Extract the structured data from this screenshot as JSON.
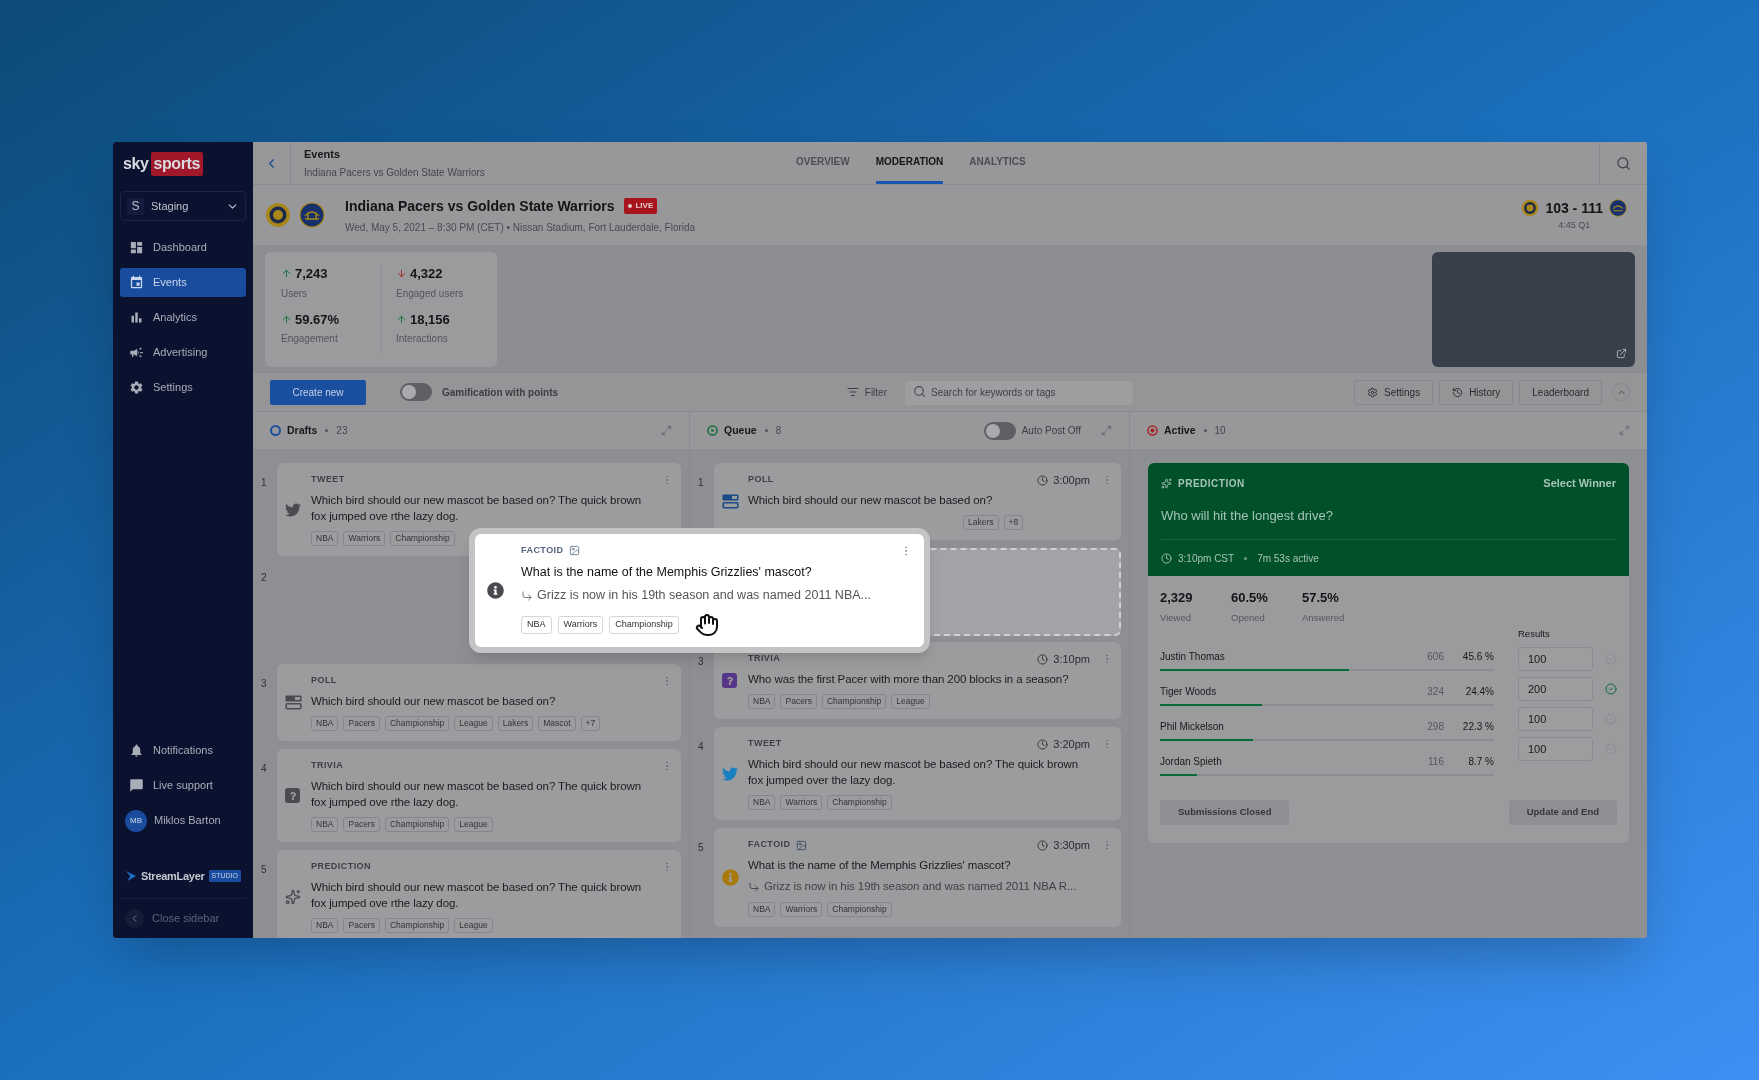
{
  "sidebar": {
    "logo": {
      "word_1": "sky",
      "word_2": "sports"
    },
    "workspace": {
      "initial": "S",
      "name": "Staging"
    },
    "nav": [
      {
        "kind": "dashboard",
        "label": "Dashboard",
        "selected": false
      },
      {
        "kind": "events",
        "label": "Events",
        "selected": true
      },
      {
        "kind": "analytics",
        "label": "Analytics",
        "selected": false
      },
      {
        "kind": "advertising",
        "label": "Advertising",
        "selected": false
      },
      {
        "kind": "settings",
        "label": "Settings",
        "selected": false
      }
    ],
    "bottom": [
      {
        "kind": "notifications",
        "label": "Notifications"
      },
      {
        "kind": "support",
        "label": "Live support"
      }
    ],
    "user": {
      "initials": "MB",
      "name": "Miklos Barton"
    },
    "brand": {
      "name": "StreamLayer",
      "badge": "STUDIO"
    },
    "close": "Close sidebar"
  },
  "breadcrumb": {
    "title": "Events",
    "subtitle": "Indiana Pacers vs Golden State Warriors"
  },
  "tabs": [
    {
      "label": "OVERVIEW",
      "selected": false
    },
    {
      "label": "MODERATION",
      "selected": true
    },
    {
      "label": "ANALYTICS",
      "selected": false
    }
  ],
  "event": {
    "title": "Indiana Pacers vs Golden State Warriors",
    "live": "LIVE",
    "meta": "Wed, May 5, 2021 – 8:30 PM (CET) • Nissan Stadium, Fort Lauderdale, Florida",
    "score": "103 - 111",
    "clock": "4:45 Q1"
  },
  "stats": [
    {
      "value": "7,243",
      "label": "Users",
      "rising": true
    },
    {
      "value": "4,322",
      "label": "Engaged users",
      "rising": false
    },
    {
      "value": "59.67%",
      "label": "Engagement",
      "rising": true
    },
    {
      "value": "18,156",
      "label": "Interactions",
      "rising": true
    }
  ],
  "toolbar": {
    "create": "Create new",
    "gamification": {
      "label": "Gamification with points",
      "on": false
    },
    "filter": "Filter",
    "search_placeholder": "Search for keywords or tags",
    "buttons": [
      {
        "kind": "settings",
        "label": "Settings"
      },
      {
        "kind": "history",
        "label": "History"
      },
      {
        "kind": "plain",
        "label": "Leaderboard"
      }
    ]
  },
  "drafts": {
    "title": "Drafts",
    "count": "23",
    "colored_icons": false,
    "items": [
      {
        "kind": "tweet",
        "number": "1",
        "type": "TWEET",
        "text": "Which bird should our new mascot be based on? The quick brown fox jumped ove rthe lazy dog.",
        "tags": [
          "NBA",
          "Warriors",
          "Championship"
        ]
      },
      {
        "kind": "empty",
        "number": "2"
      },
      {
        "kind": "poll",
        "number": "3",
        "type": "POLL",
        "text": "Which bird should our new mascot be based on?",
        "tags": [
          "NBA",
          "Pacers",
          "Championship",
          "League",
          "Lakers",
          "Mascot",
          "+7"
        ]
      },
      {
        "kind": "trivia",
        "number": "4",
        "type": "TRIVIA",
        "text": "Which bird should our new mascot be based on? The quick brown fox jumped ove rthe lazy dog.",
        "tags": [
          "NBA",
          "Pacers",
          "Championship",
          "League"
        ]
      },
      {
        "kind": "prediction",
        "number": "5",
        "type": "PREDICTION",
        "text": "Which bird should our new mascot be based on? The quick brown fox jumped ove rthe lazy dog.",
        "tags": [
          "NBA",
          "Pacers",
          "Championship",
          "League"
        ]
      }
    ]
  },
  "queue": {
    "title": "Queue",
    "count": "8",
    "colored_icons": true,
    "auto_post": {
      "label": "Auto Post Off",
      "on": false
    },
    "items": [
      {
        "kind": "poll",
        "number": "1",
        "type": "POLL",
        "time": "3:00pm",
        "text": "Which bird should our new mascot be based on?",
        "tags_covered": true,
        "tags": [
          "Lakers",
          "+8"
        ]
      },
      {
        "kind": "placeholder"
      },
      {
        "kind": "trivia",
        "number": "3",
        "type": "TRIVIA",
        "time": "3:10pm",
        "text": "Who was the first Pacer with more than 200 blocks in a season?",
        "tags": [
          "NBA",
          "Pacers",
          "Championship",
          "League"
        ]
      },
      {
        "kind": "tweet",
        "number": "4",
        "type": "TWEET",
        "time": "3:20pm",
        "text": "Which bird should our new mascot be based on? The quick brown fox jumped over the lazy dog.",
        "tags": [
          "NBA",
          "Warriors",
          "Championship"
        ]
      },
      {
        "kind": "factoid",
        "number": "5",
        "type": "FACTOID",
        "has_image": true,
        "time": "3:30pm",
        "text": "What is the name of the Memphis Grizzlies' mascot?",
        "subtext": "Grizz is now in his 19th season and was named 2011 NBA R...",
        "tags": [
          "NBA",
          "Warriors",
          "Championship"
        ]
      }
    ]
  },
  "active": {
    "title": "Active",
    "count": "10",
    "prediction": {
      "type": "PREDICTION",
      "action": "Select Winner",
      "question": "Who will hit the longest drive?",
      "time": "3:10pm CST",
      "elapsed": "7m 53s active",
      "stats": [
        {
          "value": "2,329",
          "label": "Viewed"
        },
        {
          "value": "60.5%",
          "label": "Opened"
        },
        {
          "value": "57.5%",
          "label": "Answered"
        }
      ],
      "results_label": "Results",
      "options": [
        {
          "name": "Justin Thomas",
          "votes": "606",
          "percent": "45.6 %",
          "level": 0.566,
          "result": "100",
          "selected": false
        },
        {
          "name": "Tiger Woods",
          "votes": "324",
          "percent": "24.4%",
          "level": 0.305,
          "result": "200",
          "selected": true
        },
        {
          "name": "Phil Mickelson",
          "votes": "298",
          "percent": "22.3 %",
          "level": 0.279,
          "result": "100",
          "selected": false
        },
        {
          "name": "Jordan Spieth",
          "votes": "116",
          "percent": "8.7 %",
          "level": 0.112,
          "result": "100",
          "selected": false
        }
      ],
      "buttons": [
        "Submissions Closed",
        "Update and End"
      ]
    }
  },
  "dragged": {
    "kind": "factoid",
    "type": "FACTOID",
    "has_image": true,
    "text": "What is the name of the Memphis Grizzlies' mascot?",
    "subtext": "Grizz is now in his 19th season and was named 2011 NBA...",
    "tags": [
      "NBA",
      "Warriors",
      "Championship"
    ]
  }
}
